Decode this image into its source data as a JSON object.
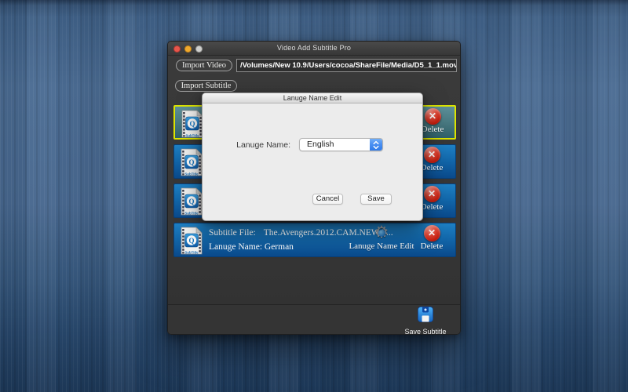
{
  "window": {
    "title": "Video Add Subtitle Pro"
  },
  "toolbar": {
    "import_video_label": "Import Video",
    "video_path": "/Volumes/New 10.9/Users/cocoa/ShareFile/Media/D5_1_1.mov",
    "import_subtitle_label": "Import Subtitle"
  },
  "rows": [
    {
      "selected": true,
      "delete_label": "Delete"
    },
    {
      "selected": false,
      "delete_label": "Delete"
    },
    {
      "selected": false,
      "delete_label": "Delete"
    },
    {
      "selected": false,
      "subtitle_file_label": "Subtitle File:",
      "subtitle_file": "The.Avengers.2012.CAM.NEW.S...",
      "language_line": "Lanuge Name: German",
      "edit_label": "Lanuge Name Edit",
      "delete_label": "Delete"
    }
  ],
  "dialog": {
    "title": "Lanuge Name Edit",
    "name_label": "Lanuge Name:",
    "selected_language": "English",
    "cancel_label": "Cancel",
    "save_label": "Save"
  },
  "footer": {
    "save_subtitle_label": "Save Subtitle"
  },
  "icons": {
    "gear": "⚙",
    "delete_x": "✕",
    "subtitle_q": "Q",
    "subtitle_text": "SubTitle"
  },
  "colors": {
    "row_blue": "#0f5ca8",
    "row_selected_teal": "#47777f",
    "selected_border": "#dde400",
    "delete_red": "#c01708",
    "popup_accent": "#2e7ae9",
    "save_icon_blue": "#1565c0",
    "wallpaper_blue": "#47678e"
  }
}
